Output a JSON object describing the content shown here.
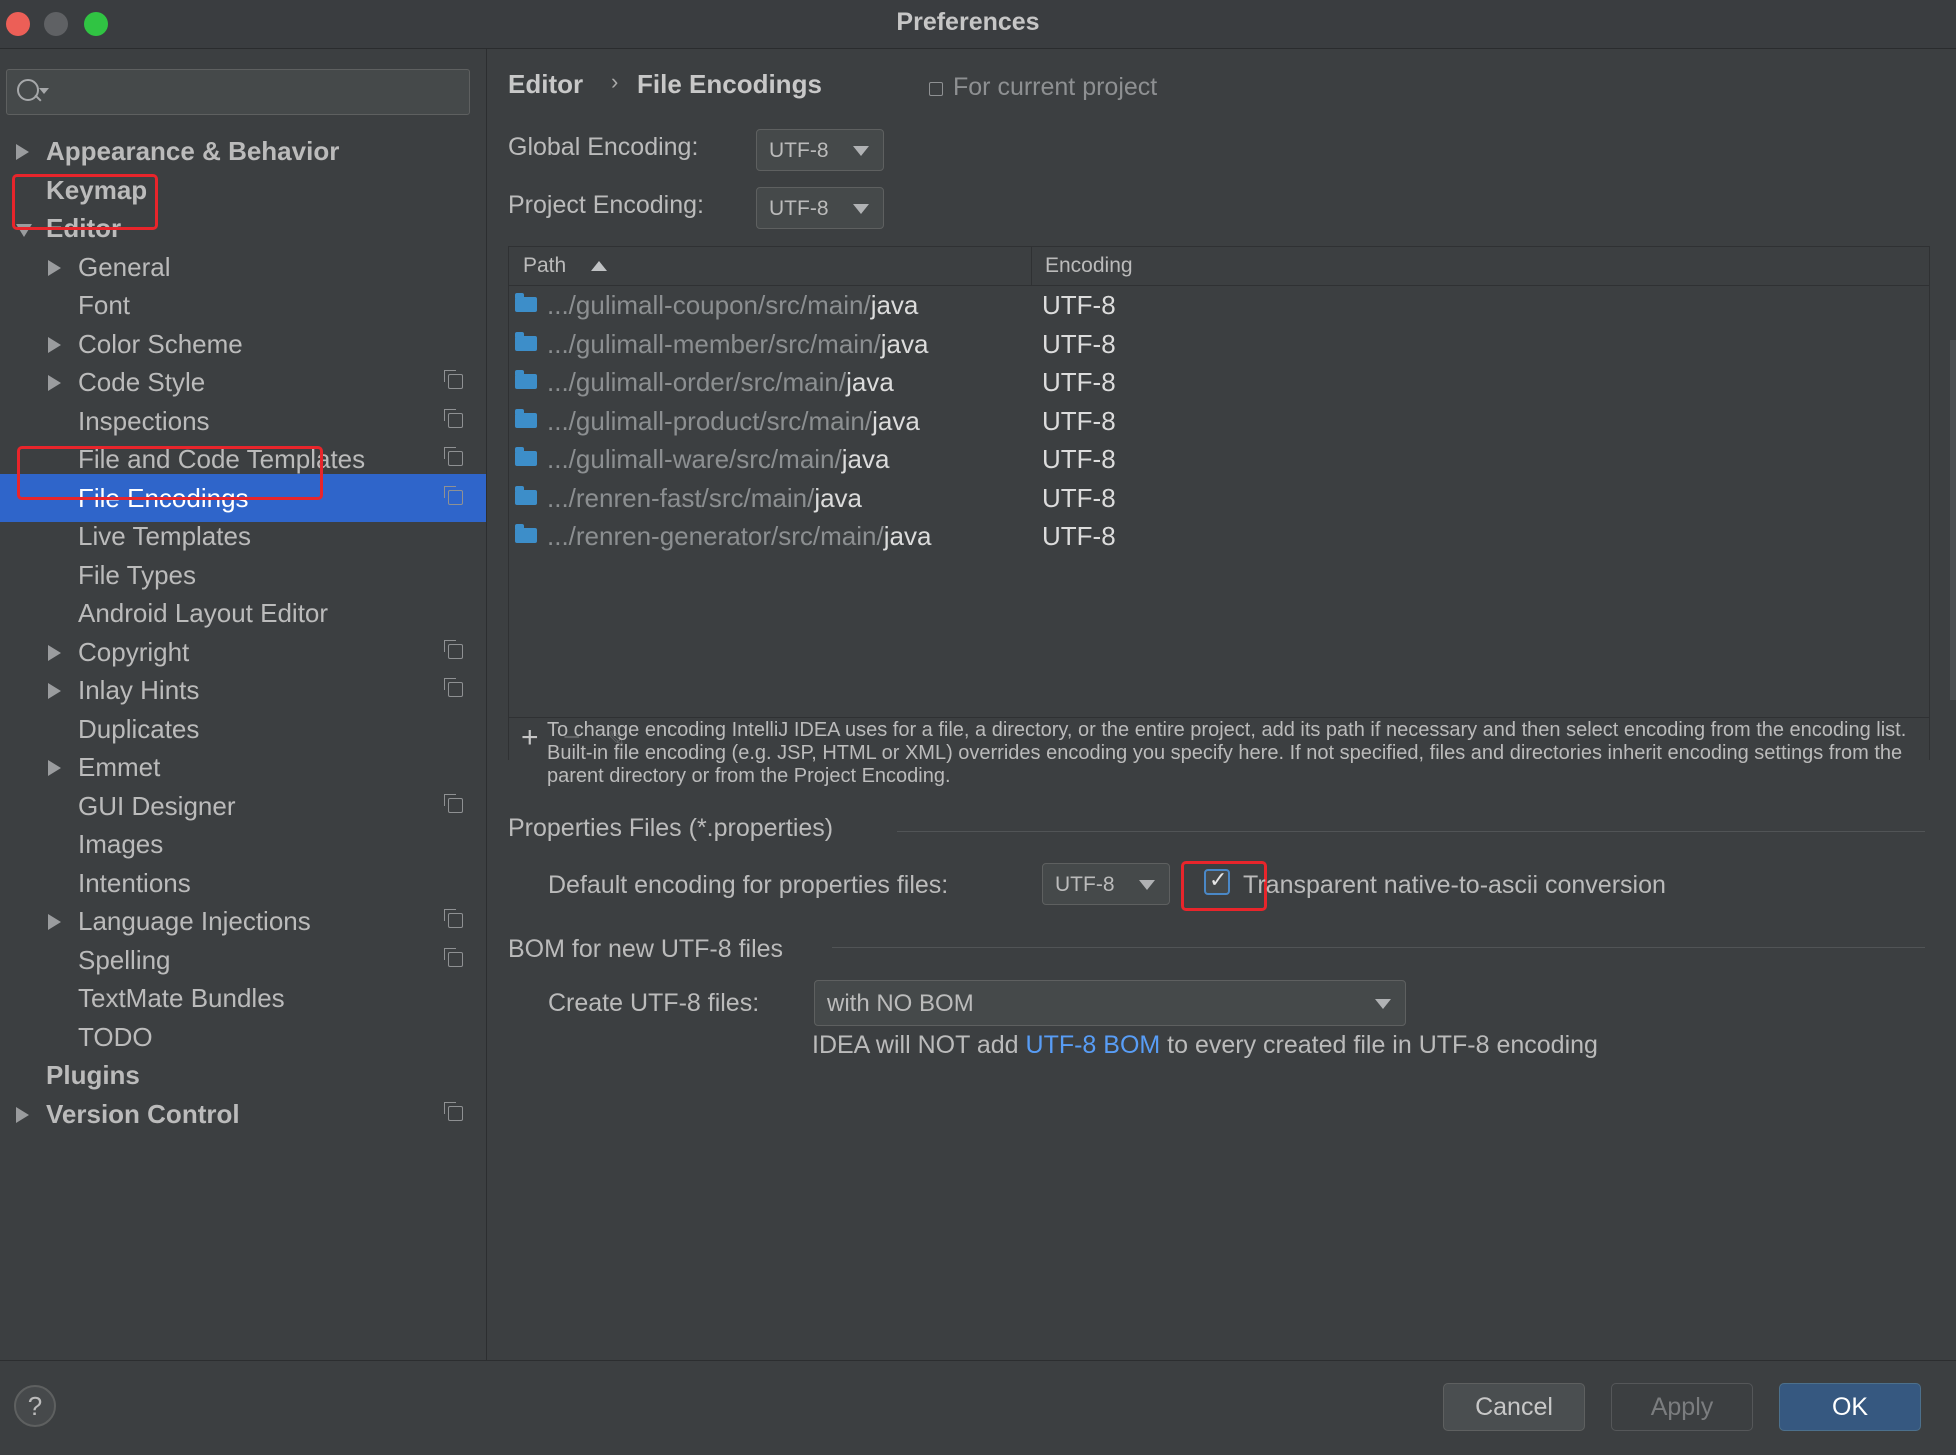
{
  "window": {
    "title": "Preferences"
  },
  "sidebar": {
    "search": {
      "placeholder": ""
    },
    "items": [
      {
        "label": "Appearance & Behavior",
        "level": 0,
        "arrow": "collapsed",
        "project_scope": false,
        "selected": false
      },
      {
        "label": "Keymap",
        "level": 0,
        "arrow": "none",
        "project_scope": false,
        "selected": false
      },
      {
        "label": "Editor",
        "level": 0,
        "arrow": "expanded",
        "project_scope": false,
        "selected": false
      },
      {
        "label": "General",
        "level": 1,
        "arrow": "collapsed",
        "project_scope": false,
        "selected": false
      },
      {
        "label": "Font",
        "level": 1,
        "arrow": "none",
        "project_scope": false,
        "selected": false
      },
      {
        "label": "Color Scheme",
        "level": 1,
        "arrow": "collapsed",
        "project_scope": false,
        "selected": false
      },
      {
        "label": "Code Style",
        "level": 1,
        "arrow": "collapsed",
        "project_scope": true,
        "selected": false
      },
      {
        "label": "Inspections",
        "level": 1,
        "arrow": "none",
        "project_scope": true,
        "selected": false
      },
      {
        "label": "File and Code Templates",
        "level": 1,
        "arrow": "none",
        "project_scope": true,
        "selected": false
      },
      {
        "label": "File Encodings",
        "level": 1,
        "arrow": "none",
        "project_scope": true,
        "selected": true
      },
      {
        "label": "Live Templates",
        "level": 1,
        "arrow": "none",
        "project_scope": false,
        "selected": false
      },
      {
        "label": "File Types",
        "level": 1,
        "arrow": "none",
        "project_scope": false,
        "selected": false
      },
      {
        "label": "Android Layout Editor",
        "level": 1,
        "arrow": "none",
        "project_scope": false,
        "selected": false
      },
      {
        "label": "Copyright",
        "level": 1,
        "arrow": "collapsed",
        "project_scope": true,
        "selected": false
      },
      {
        "label": "Inlay Hints",
        "level": 1,
        "arrow": "collapsed",
        "project_scope": true,
        "selected": false
      },
      {
        "label": "Duplicates",
        "level": 1,
        "arrow": "none",
        "project_scope": false,
        "selected": false
      },
      {
        "label": "Emmet",
        "level": 1,
        "arrow": "collapsed",
        "project_scope": false,
        "selected": false
      },
      {
        "label": "GUI Designer",
        "level": 1,
        "arrow": "none",
        "project_scope": true,
        "selected": false
      },
      {
        "label": "Images",
        "level": 1,
        "arrow": "none",
        "project_scope": false,
        "selected": false
      },
      {
        "label": "Intentions",
        "level": 1,
        "arrow": "none",
        "project_scope": false,
        "selected": false
      },
      {
        "label": "Language Injections",
        "level": 1,
        "arrow": "collapsed",
        "project_scope": true,
        "selected": false
      },
      {
        "label": "Spelling",
        "level": 1,
        "arrow": "none",
        "project_scope": true,
        "selected": false
      },
      {
        "label": "TextMate Bundles",
        "level": 1,
        "arrow": "none",
        "project_scope": false,
        "selected": false
      },
      {
        "label": "TODO",
        "level": 1,
        "arrow": "none",
        "project_scope": false,
        "selected": false
      },
      {
        "label": "Plugins",
        "level": 0,
        "arrow": "none",
        "project_scope": false,
        "selected": false
      },
      {
        "label": "Version Control",
        "level": 0,
        "arrow": "collapsed",
        "project_scope": true,
        "selected": false
      }
    ]
  },
  "main": {
    "breadcrumb": {
      "parent": "Editor",
      "separator": "›",
      "current": "File Encodings"
    },
    "scope_label": "For current project",
    "global_encoding": {
      "label": "Global Encoding:",
      "value": "UTF-8"
    },
    "project_encoding": {
      "label": "Project Encoding:",
      "value": "UTF-8"
    },
    "table": {
      "columns": {
        "path": "Path",
        "encoding": "Encoding"
      },
      "rows": [
        {
          "prefix": ".../gulimall-coupon/src/main/",
          "tail": "java",
          "encoding": "UTF-8"
        },
        {
          "prefix": ".../gulimall-member/src/main/",
          "tail": "java",
          "encoding": "UTF-8"
        },
        {
          "prefix": ".../gulimall-order/src/main/",
          "tail": "java",
          "encoding": "UTF-8"
        },
        {
          "prefix": ".../gulimall-product/src/main/",
          "tail": "java",
          "encoding": "UTF-8"
        },
        {
          "prefix": ".../gulimall-ware/src/main/",
          "tail": "java",
          "encoding": "UTF-8"
        },
        {
          "prefix": ".../renren-fast/src/main/",
          "tail": "java",
          "encoding": "UTF-8"
        },
        {
          "prefix": ".../renren-generator/src/main/",
          "tail": "java",
          "encoding": "UTF-8"
        }
      ],
      "toolbar": {
        "add": "+",
        "remove": "−",
        "edit": "✎"
      }
    },
    "description": "To change encoding IntelliJ IDEA uses for a file, a directory, or the entire project, add its path if necessary and then select encoding from the encoding list. Built-in file encoding (e.g. JSP, HTML or XML) overrides encoding you specify here. If not specified, files and directories inherit encoding settings from the parent directory or from the Project Encoding.",
    "properties_section": {
      "title": "Properties Files (*.properties)",
      "default_label": "Default encoding for properties files:",
      "default_value": "UTF-8",
      "checkbox_label": "Transparent native-to-ascii conversion",
      "checkbox_checked": true
    },
    "bom_section": {
      "title": "BOM for new UTF-8 files",
      "create_label": "Create UTF-8 files:",
      "create_value": "with NO BOM",
      "note_before": "IDEA will NOT add ",
      "note_link": "UTF-8 BOM",
      "note_after": " to every created file in UTF-8 encoding"
    }
  },
  "footer": {
    "help": "?",
    "cancel": "Cancel",
    "apply": "Apply",
    "ok": "OK"
  },
  "colors": {
    "background": "#3c3f41",
    "selection": "#2f65ca",
    "highlight_box": "#e8252b",
    "link": "#589df6",
    "folder": "#3d8ec9",
    "ok_button": "#365880"
  }
}
